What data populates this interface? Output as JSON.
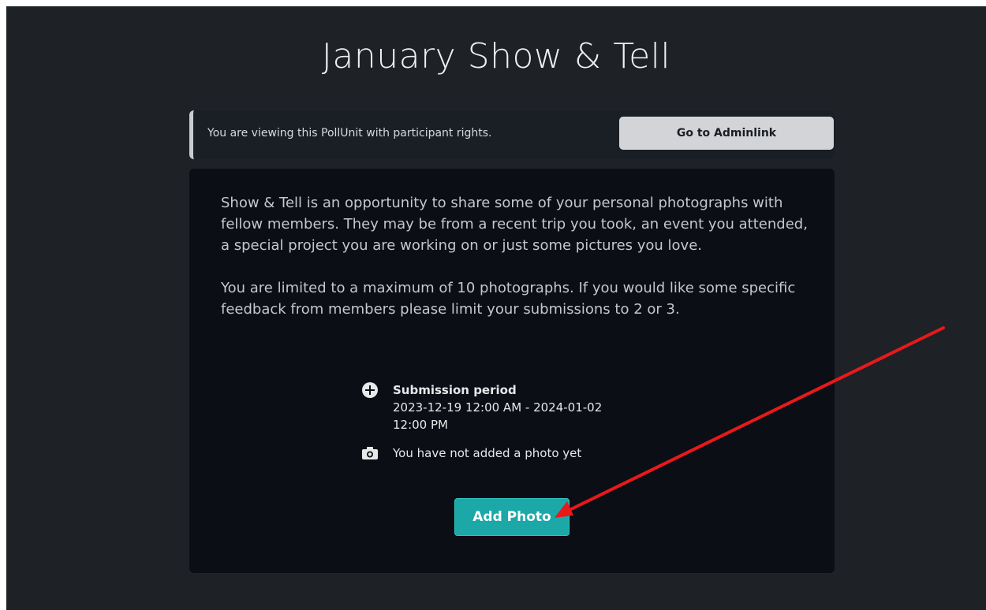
{
  "page": {
    "title": "January Show & Tell"
  },
  "notice": {
    "text": "You are viewing this PollUnit with participant rights.",
    "button_label": "Go to Adminlink"
  },
  "description": {
    "paragraphs": [
      "Show & Tell is an opportunity to share some of your personal photographs with fellow members. They may be from a recent trip you took, an event you attended, a special project you are working on or just some pictures you love.",
      "You are limited to a maximum of 10 photographs. If you would like some specific feedback from members please limit your submissions to 2 or 3."
    ]
  },
  "details": {
    "period_label": "Submission period",
    "period_value": "2023-12-19 12:00 AM - 2024-01-02 12:00 PM",
    "photo_status": "You have not added a photo yet"
  },
  "actions": {
    "add_photo_label": "Add Photo"
  },
  "icons": {
    "period": "plus-circle-icon",
    "photo": "camera-icon"
  },
  "colors": {
    "background": "#1e2227",
    "card": "#0b0e14",
    "accent": "#1ba8a7",
    "annotation": "#e8191b"
  }
}
